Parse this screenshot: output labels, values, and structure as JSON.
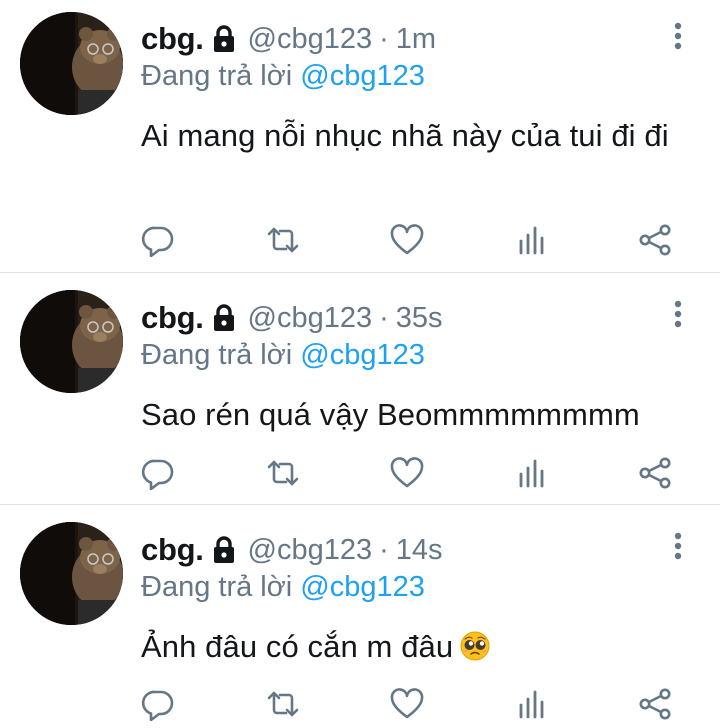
{
  "colors": {
    "name": "#14171a",
    "secondary": "#657786",
    "mention": "#1da1f2",
    "icon": "#657786",
    "divider": "#dfe3e6"
  },
  "tweets": [
    {
      "display_name": "cbg.",
      "handle": "@cbg123",
      "separator": "·",
      "time": "1m",
      "reply_prefix": "Đang trả lời",
      "reply_to": "@cbg123",
      "text": "Ai mang nỗi nhục nhã này của tui đi đi"
    },
    {
      "display_name": "cbg.",
      "handle": "@cbg123",
      "separator": "·",
      "time": "35s",
      "reply_prefix": "Đang trả lời",
      "reply_to": "@cbg123",
      "text": "Sao rén quá vậy Beommmmmmmm"
    },
    {
      "display_name": "cbg.",
      "handle": "@cbg123",
      "separator": "·",
      "time": "14s",
      "reply_prefix": "Đang trả lời",
      "reply_to": "@cbg123",
      "text": "Ảnh đâu có cắn m đâu",
      "emoji": "pleading-face-emoji"
    }
  ],
  "icons": {
    "lock": "lock-icon",
    "more": "more-vertical-icon",
    "reply": "reply-icon",
    "retweet": "retweet-icon",
    "like": "heart-icon",
    "stats": "analytics-icon",
    "share": "share-icon"
  }
}
